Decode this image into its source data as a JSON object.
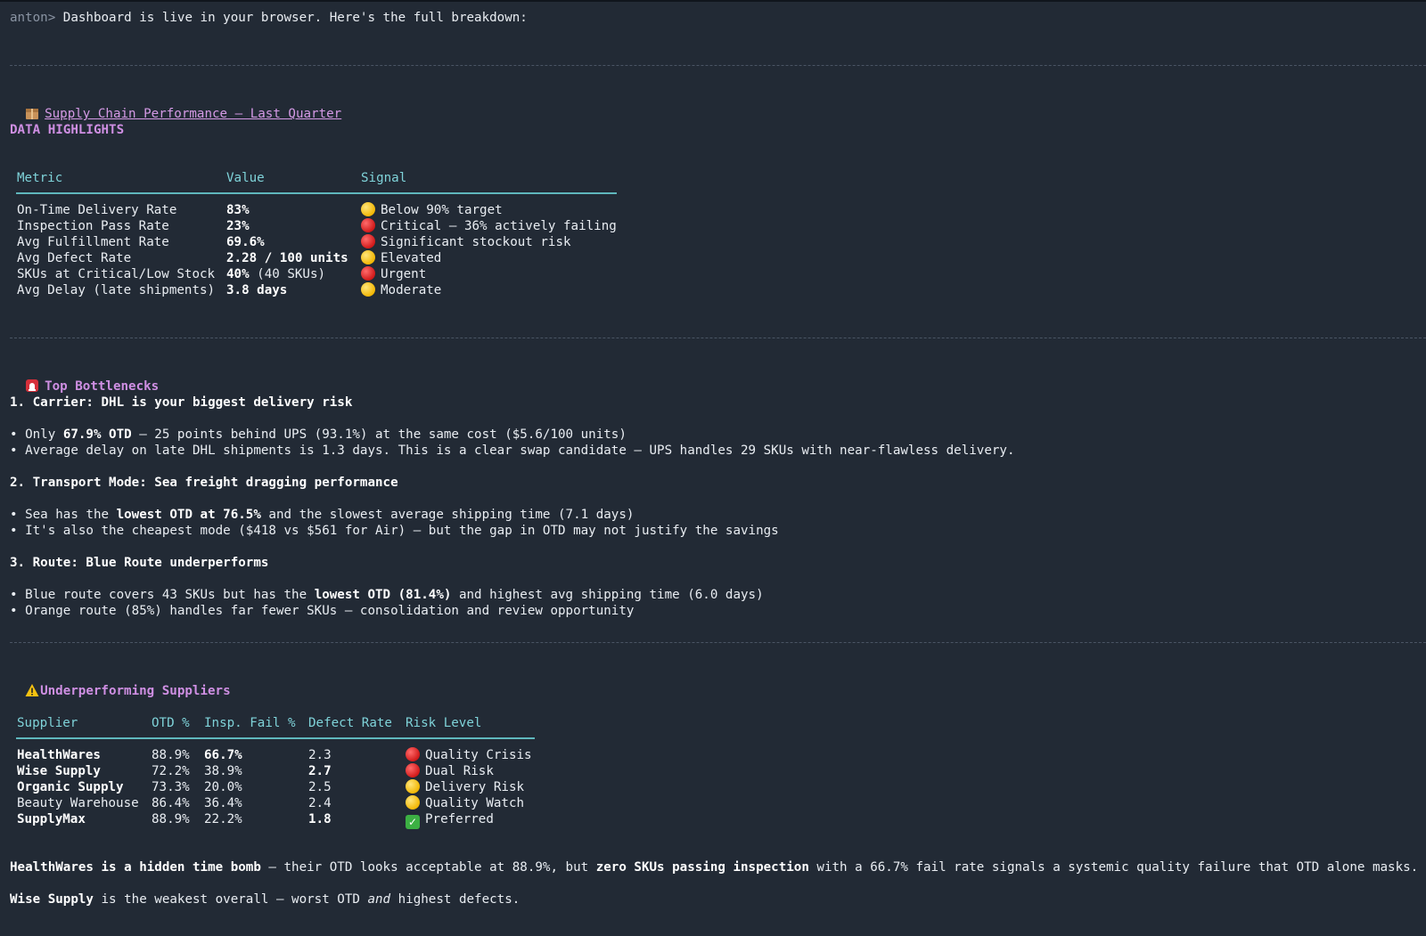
{
  "prompt": {
    "user": "anton>",
    "message": "Dashboard is live in your browser. Here's the full breakdown:"
  },
  "title": {
    "icon": "package-icon",
    "text": "Supply Chain Performance — Last Quarter"
  },
  "highlights": {
    "heading": "DATA HIGHLIGHTS",
    "columns": [
      "Metric",
      "Value",
      "Signal"
    ],
    "rows": [
      {
        "metric": "On-Time Delivery Rate",
        "value_bold": "83%",
        "value_rest": "",
        "signal": "yellow",
        "signal_text": "Below 90% target"
      },
      {
        "metric": "Inspection Pass Rate",
        "value_bold": "23%",
        "value_rest": "",
        "signal": "red",
        "signal_text": "Critical — 36% actively failing"
      },
      {
        "metric": "Avg Fulfillment Rate",
        "value_bold": "69.6%",
        "value_rest": "",
        "signal": "red",
        "signal_text": "Significant stockout risk"
      },
      {
        "metric": "Avg Defect Rate",
        "value_bold": "2.28 / 100 units",
        "value_rest": "",
        "signal": "yellow",
        "signal_text": "Elevated"
      },
      {
        "metric": "SKUs at Critical/Low Stock",
        "value_bold": "40%",
        "value_rest": " (40 SKUs)",
        "signal": "red",
        "signal_text": "Urgent"
      },
      {
        "metric": "Avg Delay (late shipments)",
        "value_bold": "3.8 days",
        "value_rest": "",
        "signal": "yellow",
        "signal_text": "Moderate"
      }
    ]
  },
  "bottlenecks": {
    "icon": "siren-icon",
    "heading": "Top Bottlenecks",
    "item1": {
      "title": "1. Carrier: DHL is your biggest delivery risk",
      "b1_a": "Only ",
      "b1_b": "67.9% OTD",
      "b1_c": " — 25 points behind UPS (93.1%) at the same cost ($5.6/100 units)",
      "b2": "Average delay on late DHL shipments is 1.3 days. This is a clear swap candidate — UPS handles 29 SKUs with near-flawless delivery."
    },
    "item2": {
      "title": "2. Transport Mode: Sea freight dragging performance",
      "b1_a": "Sea has the ",
      "b1_b": "lowest OTD at 76.5%",
      "b1_c": " and the slowest average shipping time (7.1 days)",
      "b2": "It's also the cheapest mode ($418 vs $561 for Air) — but the gap in OTD may not justify the savings"
    },
    "item3": {
      "title": "3. Route: Blue Route underperforms",
      "b1_a": "Blue route covers 43 SKUs but has the ",
      "b1_b": "lowest OTD (81.4%)",
      "b1_c": " and highest avg shipping time (6.0 days)",
      "b2": "Orange route (85%) handles far fewer SKUs — consolidation and review opportunity"
    }
  },
  "suppliers": {
    "icon": "warning-icon",
    "heading": "Underperforming Suppliers",
    "columns": [
      "Supplier",
      "OTD %",
      "Insp. Fail %",
      "Defect Rate",
      "Risk Level"
    ],
    "rows": [
      {
        "name": "HealthWares",
        "otd": "88.9%",
        "insp": "66.7%",
        "defect": "2.3",
        "risk": "red",
        "risk_text": "Quality Crisis"
      },
      {
        "name": "Wise Supply",
        "otd": "72.2%",
        "insp": "38.9%",
        "defect": "2.7",
        "risk": "red",
        "risk_text": "Dual Risk"
      },
      {
        "name": "Organic Supply",
        "otd": "73.3%",
        "insp": "20.0%",
        "defect": "2.5",
        "risk": "yellow",
        "risk_text": "Delivery Risk"
      },
      {
        "name": "Beauty Warehouse",
        "otd": "86.4%",
        "insp": "36.4%",
        "defect": "2.4",
        "risk": "yellow",
        "risk_text": "Quality Watch"
      },
      {
        "name": "SupplyMax",
        "otd": "88.9%",
        "insp": "22.2%",
        "defect": "1.8",
        "risk": "check",
        "risk_text": "Preferred"
      }
    ]
  },
  "summary": {
    "p1_a": "HealthWares is a hidden time bomb",
    "p1_b": " — their OTD looks acceptable at 88.9%, but ",
    "p1_c": "zero SKUs passing inspection",
    "p1_d": " with a 66.7% fail rate signals a systemic quality failure that OTD alone masks.",
    "p2_a": "Wise Supply",
    "p2_b": " is the weakest overall — worst OTD ",
    "p2_c": "and",
    "p2_d": " highest defects."
  }
}
